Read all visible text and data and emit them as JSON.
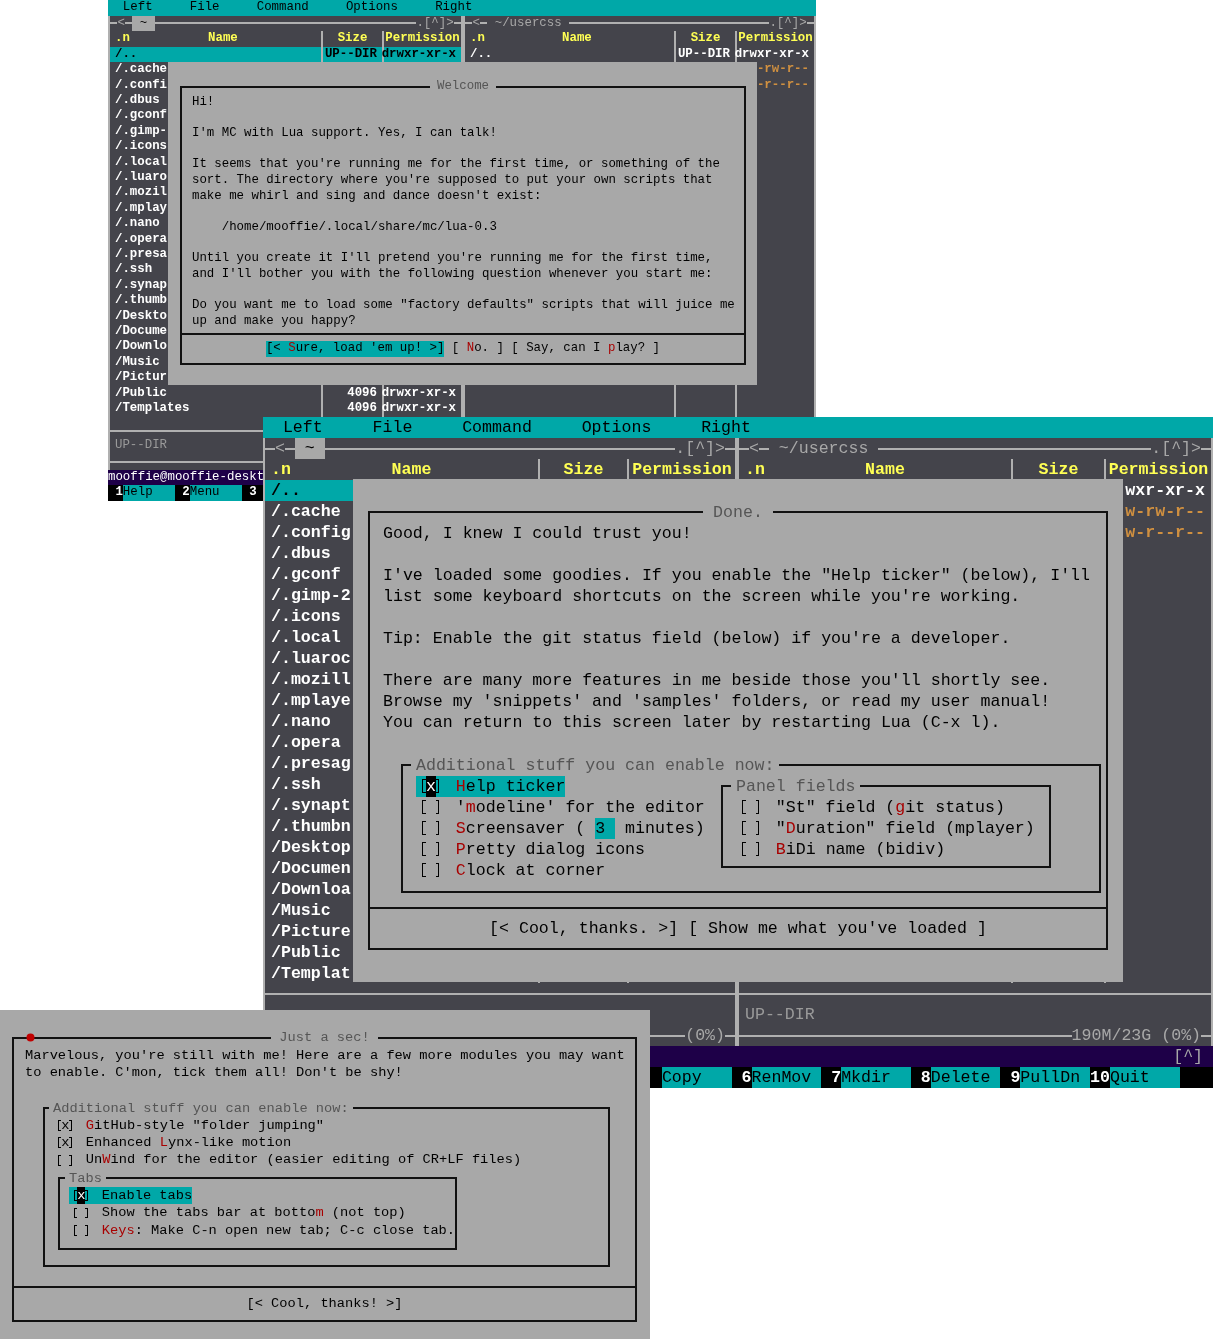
{
  "windows": [
    {
      "kind": "commander",
      "menu": [
        "Left",
        "File",
        "Command",
        "Options",
        "Right"
      ],
      "left_panel": {
        "back": "<",
        "tab": "~",
        "corner": ".[^]>",
        "columns": [
          ".n",
          "Name",
          "Size",
          "Permission"
        ],
        "status": "UP--DIR",
        "rows": [
          {
            "name": "/..",
            "size": "UP--DIR",
            "permission": "drwxr-xr-x",
            "kind": "dir",
            "selected": true
          },
          {
            "name": "/.cache",
            "kind": "dir",
            "selected": false
          },
          {
            "name": "/.confi",
            "kind": "dir",
            "selected": false
          },
          {
            "name": "/.dbus",
            "kind": "dir",
            "selected": false
          },
          {
            "name": "/.gconf",
            "kind": "dir",
            "selected": false
          },
          {
            "name": "/.gimp-",
            "kind": "dir",
            "selected": false
          },
          {
            "name": "/.icons",
            "kind": "dir",
            "selected": false
          },
          {
            "name": "/.local",
            "kind": "dir",
            "selected": false
          },
          {
            "name": "/.luaro",
            "kind": "dir",
            "selected": false
          },
          {
            "name": "/.mozil",
            "kind": "dir",
            "selected": false
          },
          {
            "name": "/.mplay",
            "kind": "dir",
            "selected": false
          },
          {
            "name": "/.nano",
            "kind": "dir",
            "selected": false
          },
          {
            "name": "/.opera",
            "kind": "dir",
            "selected": false
          },
          {
            "name": "/.presa",
            "kind": "dir",
            "selected": false
          },
          {
            "name": "/.ssh",
            "kind": "dir",
            "selected": false
          },
          {
            "name": "/.synap",
            "kind": "dir",
            "selected": false
          },
          {
            "name": "/.thumb",
            "kind": "dir",
            "selected": false
          },
          {
            "name": "/Deskto",
            "kind": "dir",
            "selected": false
          },
          {
            "name": "/Docume",
            "kind": "dir",
            "selected": false
          },
          {
            "name": "/Downlo",
            "kind": "dir",
            "selected": false
          },
          {
            "name": "/Music",
            "kind": "dir",
            "selected": false
          },
          {
            "name": "/Pictur",
            "kind": "dir",
            "selected": false
          },
          {
            "name": "/Public",
            "size": "4096",
            "permission": "drwxr-xr-x",
            "kind": "dir",
            "selected": false
          },
          {
            "name": "/Templates",
            "size": "4096",
            "permission": "drwxr-xr-x",
            "kind": "dir",
            "selected": false
          }
        ]
      },
      "right_panel": {
        "back": "<",
        "path": "~/usercss",
        "corner": ".[^]>",
        "columns": [
          ".n",
          "Name",
          "Size",
          "Permission"
        ],
        "rows": [
          {
            "name": "/..",
            "size": "UP--DIR",
            "permission": "drwxr-xr-x",
            "kind": "dir",
            "selected": false
          },
          {
            "permission": "-rw-r--",
            "kind": "file",
            "selected": false
          },
          {
            "permission": "-r--r--",
            "kind": "file",
            "selected": false
          }
        ]
      },
      "command_line": {
        "prompt": "mooffie@mooffie-deskt"
      },
      "keys": [
        {
          "number": "1",
          "label": "Help"
        },
        {
          "number": "2",
          "label": "Menu"
        },
        {
          "number": "3"
        }
      ],
      "dialog": {
        "title": "Welcome",
        "paragraphs": [
          "Hi!",
          "I'm MC with Lua support. Yes, I can talk!",
          "It seems that you're running me for the first time, or something of the\nsort. The directory where you're supposed to put your own scripts that\nmake me whirl and sing and dance doesn't exist:",
          "    /home/mooffie/.local/share/mc/lua-0.3",
          "Until you create it I'll pretend you're running me for the first time,\nand I'll bother you with the following question whenever you start me:",
          "Do you want me to load some \"factory defaults\" scripts that will juice me\nup and make you happy?"
        ],
        "buttons": [
          {
            "before": "[< ",
            "hotkey": "S",
            "after": "ure, load 'em up! >]",
            "selected": true
          },
          {
            "before": "[ ",
            "hotkey": "N",
            "after": "o. ]",
            "selected": false
          },
          {
            "before": "[ Say, can I ",
            "hotkey": "p",
            "after": "lay? ]",
            "selected": false
          }
        ]
      }
    },
    {
      "kind": "commander",
      "menu": [
        "Left",
        "File",
        "Command",
        "Options",
        "Right"
      ],
      "left_panel": {
        "back": "<",
        "tab": "~",
        "corner": ".[^]>",
        "columns": [
          ".n",
          "Name",
          "Size",
          "Permission"
        ],
        "footer": "(0%)",
        "rows": [
          {
            "name": "/..",
            "kind": "dir",
            "selected": true
          },
          {
            "name": "/.cache",
            "kind": "dir",
            "selected": false
          },
          {
            "name": "/.config",
            "kind": "dir",
            "selected": false
          },
          {
            "name": "/.dbus",
            "kind": "dir",
            "selected": false
          },
          {
            "name": "/.gconf",
            "kind": "dir",
            "selected": false
          },
          {
            "name": "/.gimp-2",
            "kind": "dir",
            "selected": false
          },
          {
            "name": "/.icons",
            "kind": "dir",
            "selected": false
          },
          {
            "name": "/.local",
            "kind": "dir",
            "selected": false
          },
          {
            "name": "/.luaroc",
            "kind": "dir",
            "selected": false
          },
          {
            "name": "/.mozill",
            "kind": "dir",
            "selected": false
          },
          {
            "name": "/.mplaye",
            "kind": "dir",
            "selected": false
          },
          {
            "name": "/.nano",
            "kind": "dir",
            "selected": false
          },
          {
            "name": "/.opera",
            "kind": "dir",
            "selected": false
          },
          {
            "name": "/.presag",
            "kind": "dir",
            "selected": false
          },
          {
            "name": "/.ssh",
            "kind": "dir",
            "selected": false
          },
          {
            "name": "/.synapt",
            "kind": "dir",
            "selected": false
          },
          {
            "name": "/.thumbn",
            "kind": "dir",
            "selected": false
          },
          {
            "name": "/Desktop",
            "kind": "dir",
            "selected": false
          },
          {
            "name": "/Documen",
            "kind": "dir",
            "selected": false
          },
          {
            "name": "/Downloa",
            "kind": "dir",
            "selected": false
          },
          {
            "name": "/Music",
            "kind": "dir",
            "selected": false
          },
          {
            "name": "/Picture",
            "kind": "dir",
            "selected": false
          },
          {
            "name": "/Public",
            "kind": "dir",
            "selected": false
          },
          {
            "name": "/Templat",
            "kind": "dir",
            "selected": false
          }
        ]
      },
      "right_panel": {
        "back": "<",
        "path": "~/usercss",
        "corner": ".[^]>",
        "columns": [
          ".n",
          "Name",
          "Size",
          "Permission"
        ],
        "status": "UP--DIR",
        "footer": "190M/23G (0%)",
        "rows": [
          {
            "permission": "wxr-xr-x",
            "kind": "dir",
            "selected": false
          },
          {
            "permission": "w-rw-r--",
            "kind": "file",
            "selected": false
          },
          {
            "permission": "w-r--r--",
            "kind": "file",
            "selected": false
          }
        ]
      },
      "command_line": {
        "indicator": "[^]"
      },
      "keys": [
        {
          "label": "Copy"
        },
        {
          "number": "6",
          "label": "RenMov"
        },
        {
          "number": "7",
          "label": "Mkdir"
        },
        {
          "number": "8",
          "label": "Delete"
        },
        {
          "number": "9",
          "label": "PullDn"
        },
        {
          "number": "10",
          "label": "Quit"
        }
      ],
      "dialog": {
        "title": "Done.",
        "paragraphs": [
          "Good, I knew I could trust you!",
          "I've loaded some goodies. If you enable the \"Help ticker\" (below), I'll\nlist some keyboard shortcuts on the screen while you're working.",
          "Tip: Enable the git status field (below) if you're a developer.",
          "There are many more features in me beside those you'll shortly see.\nBrowse my 'snippets' and 'samples' folders, or read my user manual!\nYou can return to this screen later by restarting Lua (C-x l)."
        ],
        "options": {
          "title": "Additional stuff you can enable now:",
          "items": [
            {
              "hotkey": "H",
              "after": "elp ticker",
              "checked": true,
              "mark": "x",
              "selected": true
            },
            {
              "before": "'",
              "hotkey": "m",
              "after": "odeline' for the editor",
              "checked": false,
              "selected": false
            },
            {
              "hotkey": "S",
              "after": "creensaver (",
              "input": "3",
              "suffix": " minutes)",
              "checked": false,
              "selected": false
            },
            {
              "hotkey": "P",
              "after": "retty dialog icons",
              "checked": false,
              "selected": false
            },
            {
              "hotkey": "C",
              "after": "lock at corner",
              "checked": false,
              "selected": false
            }
          ],
          "subgroup": {
            "kind": "side",
            "title": "Panel fields",
            "items": [
              {
                "before": "\"St\" field (",
                "hotkey": "g",
                "after": "it status)",
                "checked": false,
                "selected": false
              },
              {
                "before": "\"",
                "hotkey": "D",
                "after": "uration\" field (mplayer)",
                "checked": false,
                "selected": false
              },
              {
                "hotkey": "B",
                "after": "iDi name (bidiv)",
                "checked": false,
                "selected": false
              }
            ]
          }
        },
        "buttons": [
          {
            "before": "[< Cool, thanks. >]",
            "selected": false
          },
          {
            "before": "[ Show me what you've loaded ]",
            "selected": false
          }
        ]
      }
    },
    {
      "kind": "dialog",
      "dialog": {
        "title": "Just a sec!",
        "paragraphs": [
          "Marvelous, you're still with me! Here are a few more modules you may want\nto enable. C'mon, tick them all! Don't be shy!"
        ],
        "options": {
          "title": "Additional stuff you can enable now:",
          "items": [
            {
              "hotkey": "G",
              "after": "itHub-style \"folder jumping\"",
              "checked": true,
              "mark": "x",
              "selected": false
            },
            {
              "before": "Enhanced ",
              "hotkey": "L",
              "after": "ynx-like motion",
              "checked": true,
              "mark": "x",
              "selected": false
            },
            {
              "before": "Un",
              "hotkey": "W",
              "after": "ind for the editor (easier editing of CR+LF files)",
              "checked": false,
              "selected": false
            }
          ],
          "subgroup": {
            "kind": "below",
            "title": "Tabs",
            "items": [
              {
                "before": "Enable tabs",
                "checked": true,
                "mark": "x",
                "selected": true
              },
              {
                "before": "Show the tabs bar at botto",
                "hotkey": "m",
                "after": " (not top)",
                "checked": false,
                "selected": false
              },
              {
                "hotkey": "Keys",
                "after": ": Make C-n open new tab; C-c close tab.",
                "checked": false,
                "selected": false
              }
            ]
          }
        },
        "buttons": [
          {
            "before": "[< Cool, thanks! >]",
            "selected": false
          }
        ]
      }
    }
  ]
}
